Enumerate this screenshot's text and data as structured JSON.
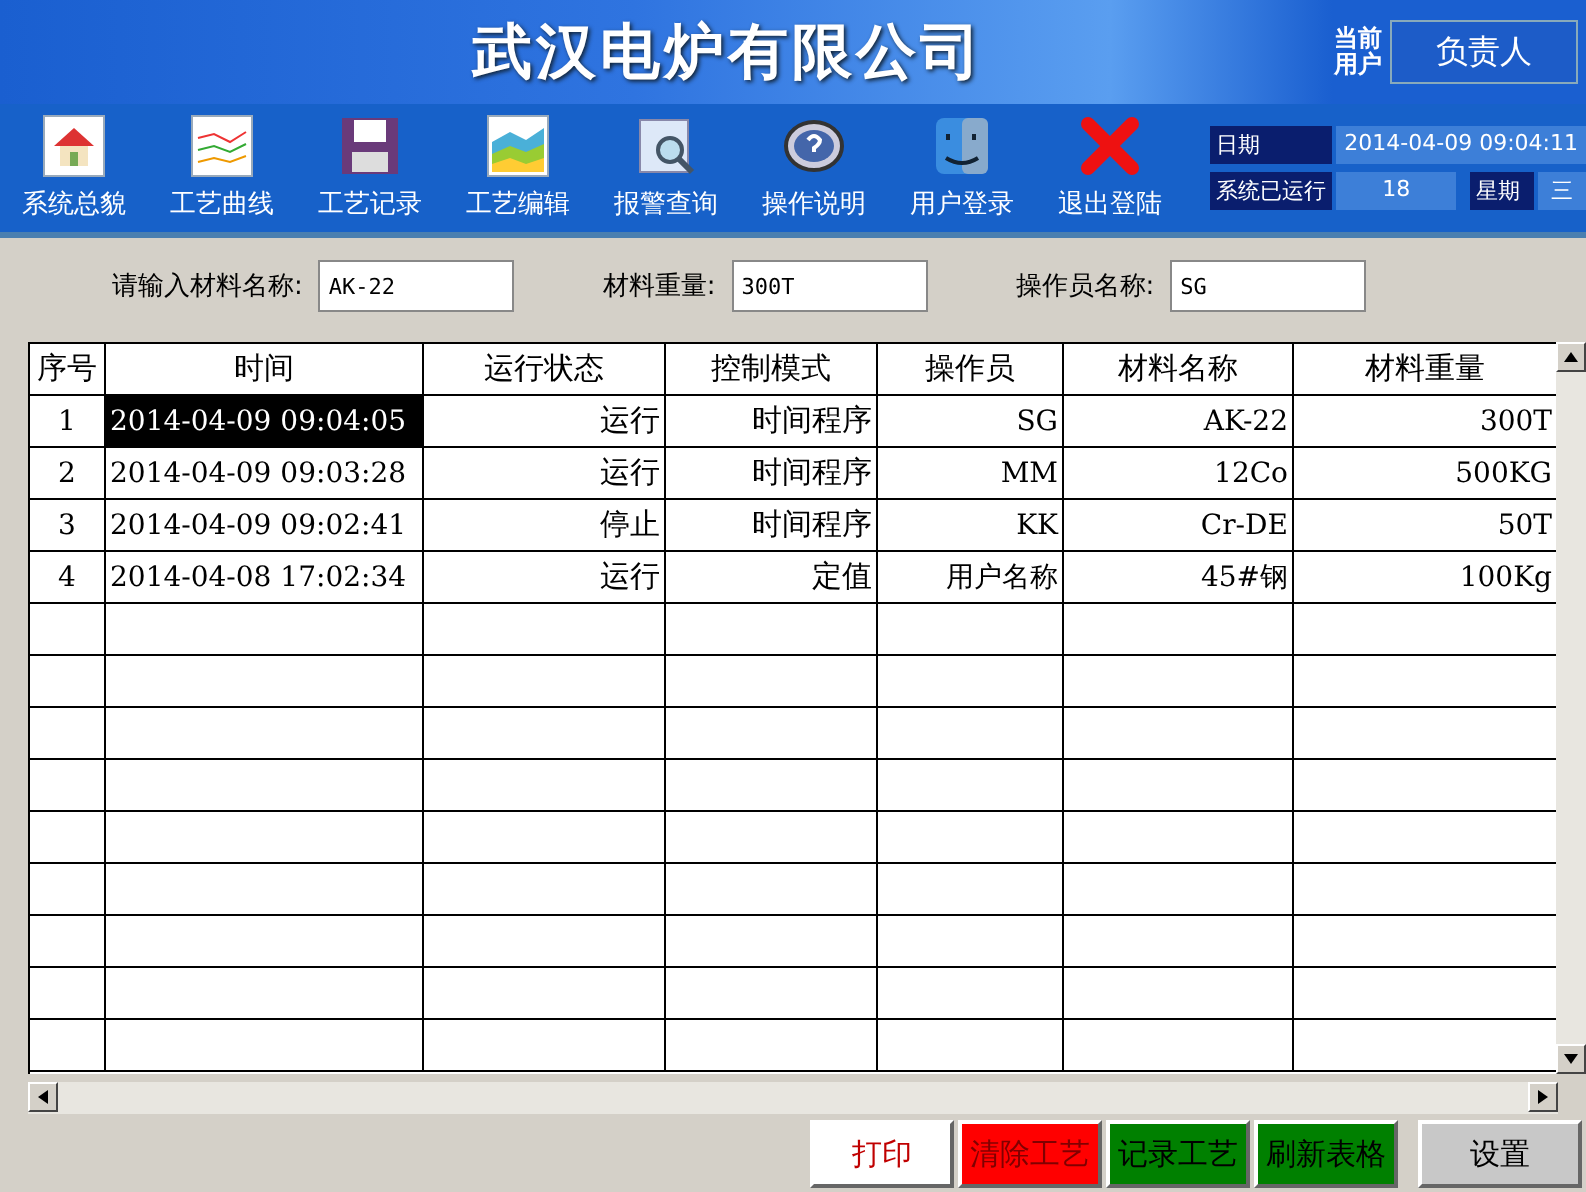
{
  "header": {
    "company": "武汉电炉有限公司",
    "user_label": "当前用户",
    "user": "负责人"
  },
  "toolbar": [
    {
      "label": "系统总貌",
      "kind": "house"
    },
    {
      "label": "工艺曲线",
      "kind": "lines"
    },
    {
      "label": "工艺记录",
      "kind": "floppy"
    },
    {
      "label": "工艺编辑",
      "kind": "area"
    },
    {
      "label": "报警查询",
      "kind": "search"
    },
    {
      "label": "操作说明",
      "kind": "help"
    },
    {
      "label": "用户登录",
      "kind": "face"
    },
    {
      "label": "退出登陆",
      "kind": "cross"
    }
  ],
  "status": {
    "date_label": "日期",
    "date": "2014-04-09 09:04:11",
    "runtime_label": "系统已运行",
    "runtime": "18",
    "weekday_label": "星期",
    "weekday": "三"
  },
  "form": [
    {
      "label": "请输入材料名称:",
      "value": "AK-22"
    },
    {
      "label": "材料重量:",
      "value": "300T"
    },
    {
      "label": "操作员名称:",
      "value": "SG"
    }
  ],
  "table": {
    "columns": [
      "序号",
      "时间",
      "运行状态",
      "控制模式",
      "操作员",
      "材料名称",
      "材料重量"
    ],
    "rows": [
      {
        "selected": true,
        "cells": [
          "1",
          "2014-04-09 09:04:05",
          "运行",
          "时间程序",
          "SG",
          "AK-22",
          "300T"
        ]
      },
      {
        "selected": false,
        "cells": [
          "2",
          "2014-04-09 09:03:28",
          "运行",
          "时间程序",
          "MM",
          "12Co",
          "500KG"
        ]
      },
      {
        "selected": false,
        "cells": [
          "3",
          "2014-04-09 09:02:41",
          "停止",
          "时间程序",
          "KK",
          "Cr-DE",
          "50T"
        ]
      },
      {
        "selected": false,
        "cells": [
          "4",
          "2014-04-08 17:02:34",
          "运行",
          "定值",
          "用户名称",
          "45#钢",
          "100Kg"
        ]
      }
    ]
  },
  "buttons": [
    {
      "label": "打印",
      "color": "#ffffff"
    },
    {
      "label": "清除工艺",
      "color": "#ff0000"
    },
    {
      "label": "记录工艺",
      "color": "#008000"
    },
    {
      "label": "刷新表格",
      "color": "#008000"
    },
    {
      "label": "设置",
      "color": "#c8c8c8"
    }
  ]
}
